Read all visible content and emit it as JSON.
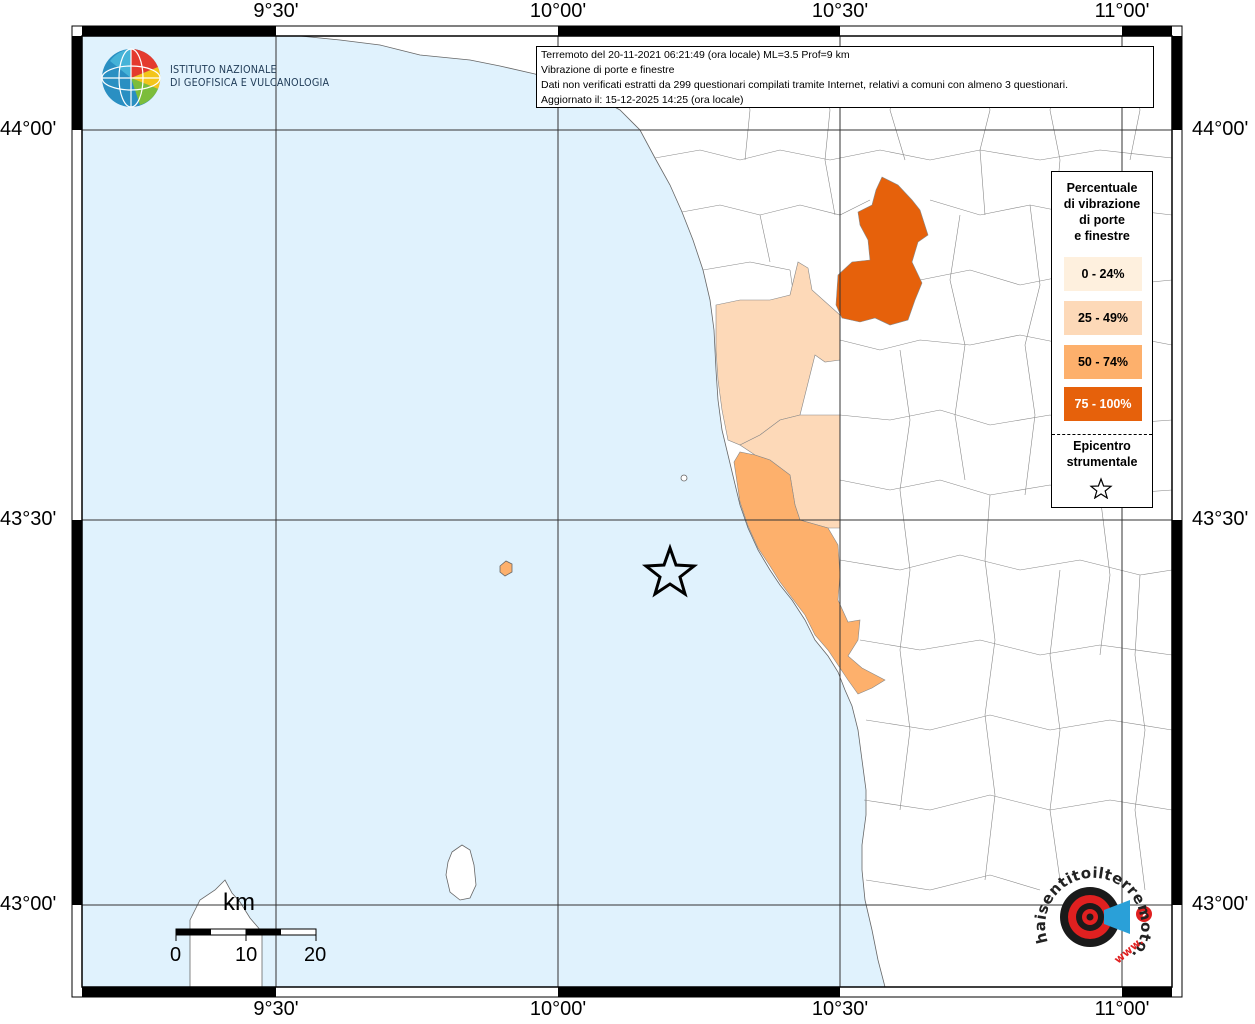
{
  "map": {
    "top_ticks": [
      "9°30'",
      "10°00'",
      "10°30'",
      "11°00'"
    ],
    "bottom_ticks": [
      "9°30'",
      "10°00'",
      "10°30'",
      "11°00'"
    ],
    "left_ticks": [
      "44°00'",
      "43°30'",
      "43°00'"
    ],
    "right_ticks": [
      "44°00'",
      "43°30'",
      "43°00'"
    ],
    "colors": {
      "sea": "#e0f2fd",
      "land": "#ffffff",
      "c0_24": "#fef0de",
      "c25_49": "#fdd9b8",
      "c50_74": "#fdb06c",
      "c75_100": "#e6610b"
    }
  },
  "logo": {
    "line1": "ISTITUTO NAZIONALE",
    "line2": "DI GEOFISICA E VULCANOLOGIA"
  },
  "info": {
    "line1": "Terremoto del 20-11-2021 06:21:49 (ora locale) ML=3.5 Prof=9 km",
    "line2": "Vibrazione di porte e finestre",
    "line3": "Dati non verificati estratti da 299 questionari compilati tramite Internet, relativi a comuni con almeno 3 questionari.",
    "line4": "Aggiornato il: 15-12-2025 14:25 (ora locale)"
  },
  "legend": {
    "title_l1": "Percentuale",
    "title_l2": "di vibrazione",
    "title_l3": "di porte",
    "title_l4": "e finestre",
    "items": [
      {
        "label": "0 - 24%"
      },
      {
        "label": "25 - 49%"
      },
      {
        "label": "50 - 74%"
      },
      {
        "label": "75 - 100%"
      }
    ],
    "epi_l1": "Epicentro",
    "epi_l2": "strumentale"
  },
  "scale": {
    "unit": "km",
    "labels": [
      "0",
      "10",
      "20"
    ]
  },
  "hst": {
    "text": "haisentitoilterremoto.it",
    "prefix": "www."
  }
}
